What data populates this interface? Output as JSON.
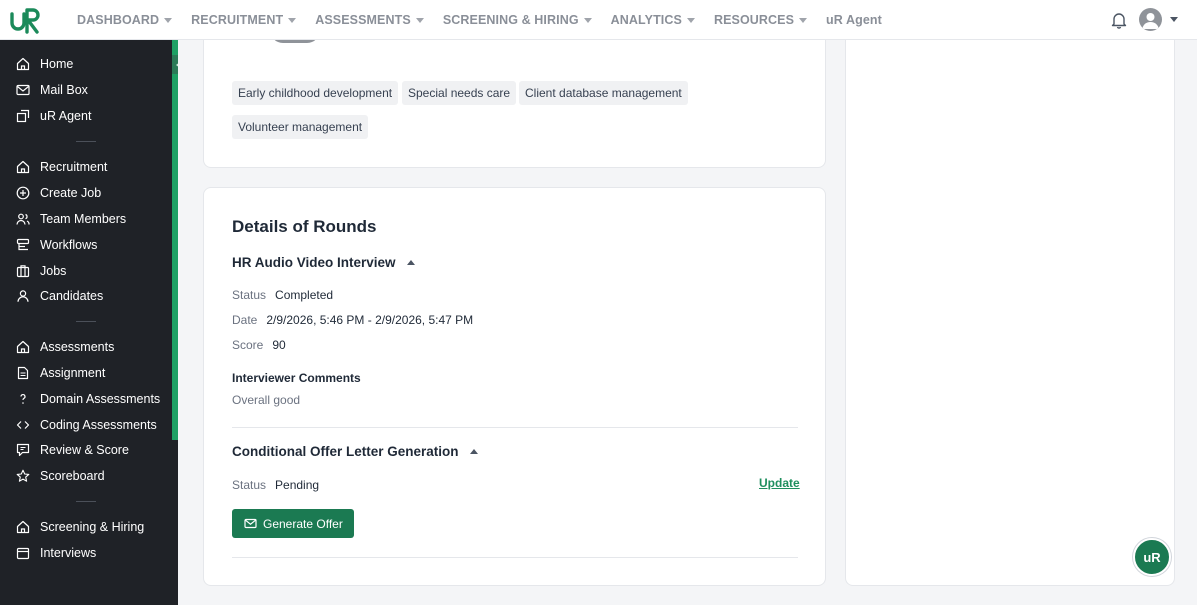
{
  "brand": {
    "logo_text": "uR"
  },
  "topnav": {
    "items": [
      {
        "label": "DASHBOARD",
        "has_caret": true
      },
      {
        "label": "RECRUITMENT",
        "has_caret": true
      },
      {
        "label": "ASSESSMENTS",
        "has_caret": true
      },
      {
        "label": "SCREENING & HIRING",
        "has_caret": true
      },
      {
        "label": "ANALYTICS",
        "has_caret": true
      },
      {
        "label": "RESOURCES",
        "has_caret": true
      },
      {
        "label": "uR Agent",
        "has_caret": false
      }
    ]
  },
  "sidebar": {
    "items": [
      {
        "label": "Home",
        "icon": "home-icon"
      },
      {
        "label": "Mail Box",
        "icon": "mail-icon"
      },
      {
        "label": "uR Agent",
        "icon": "agent-icon"
      },
      {
        "label": "Recruitment",
        "icon": "home-icon"
      },
      {
        "label": "Create Job",
        "icon": "plus-circle-icon"
      },
      {
        "label": "Team Members",
        "icon": "users-icon"
      },
      {
        "label": "Workflows",
        "icon": "workflow-icon"
      },
      {
        "label": "Jobs",
        "icon": "briefcase-icon"
      },
      {
        "label": "Candidates",
        "icon": "user-icon"
      },
      {
        "label": "Assessments",
        "icon": "home-icon"
      },
      {
        "label": "Assignment",
        "icon": "document-icon"
      },
      {
        "label": "Domain Assessments",
        "icon": "question-icon"
      },
      {
        "label": "Coding Assessments",
        "icon": "code-icon"
      },
      {
        "label": "Review & Score",
        "icon": "review-icon"
      },
      {
        "label": "Scoreboard",
        "icon": "star-icon"
      },
      {
        "label": "Screening & Hiring",
        "icon": "home-icon"
      },
      {
        "label": "Interviews",
        "icon": "calendar-icon"
      }
    ]
  },
  "skills": {
    "tags": [
      "Early childhood development",
      "Special needs care",
      "Client database management",
      "Volunteer management"
    ]
  },
  "rounds": {
    "title": "Details of Rounds",
    "hr_interview": {
      "title": "HR Audio Video Interview",
      "status_label": "Status",
      "status_value": "Completed",
      "date_label": "Date",
      "date_value": "2/9/2026, 5:46 PM - 2/9/2026, 5:47 PM",
      "score_label": "Score",
      "score_value": "90",
      "comments_label": "Interviewer Comments",
      "comments_value": "Overall good"
    },
    "offer": {
      "title": "Conditional Offer Letter Generation",
      "status_label": "Status",
      "status_value": "Pending",
      "update_label": "Update",
      "generate_label": "Generate Offer"
    }
  },
  "colors": {
    "accent": "#1b7a52",
    "sidebar_bg": "#1f2227",
    "sidebar_accent": "#1ea064"
  }
}
